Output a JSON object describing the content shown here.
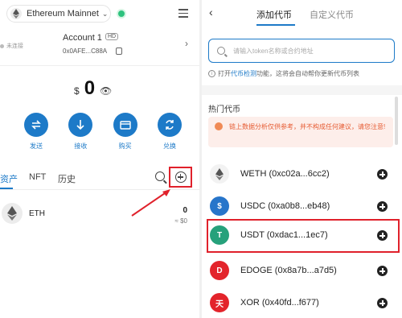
{
  "wallet": {
    "network": "Ethereum Mainnet",
    "connection_status": "未连接",
    "account_name": "Account 1",
    "account_badge": "HD",
    "account_address": "0x0AFE...C88A",
    "balance_currency": "$",
    "balance_value": "0",
    "actions": [
      {
        "label": "发送",
        "icon": "send-icon"
      },
      {
        "label": "接收",
        "icon": "receive-icon"
      },
      {
        "label": "购买",
        "icon": "buy-icon"
      },
      {
        "label": "兑换",
        "icon": "swap-icon"
      }
    ],
    "tabs": [
      "资产",
      "NFT",
      "历史"
    ],
    "assets": [
      {
        "symbol": "ETH",
        "amount": "0",
        "fiat": "≈ $0"
      }
    ]
  },
  "add_token": {
    "tabs": [
      "添加代币",
      "自定义代币"
    ],
    "search_placeholder": "请输入token名称或合约地址",
    "info_prefix": "打开",
    "info_link": "代币检测",
    "info_suffix": "功能，这将会自动帮你更新代币列表",
    "hot_title": "热门代币",
    "warning": "链上数据分析仅供参考，并不构成任何建议，请您注意!",
    "tokens": [
      {
        "name": "WETH (0xc02a...6cc2)",
        "color": "#f2f2f2"
      },
      {
        "name": "USDC (0xa0b8...eb48)",
        "color": "#2775ca"
      },
      {
        "name": "USDT (0xdac1...1ec7)",
        "color": "#26a17b"
      },
      {
        "name": "EDOGE (0x8a7b...a7d5)",
        "color": "#e3242b"
      },
      {
        "name": "XOR (0x40fd...f677)",
        "color": "#e3242b"
      }
    ]
  },
  "colors": {
    "accent": "#1d7ac8",
    "highlight": "#e0212b",
    "status_green": "#2ec27e"
  }
}
